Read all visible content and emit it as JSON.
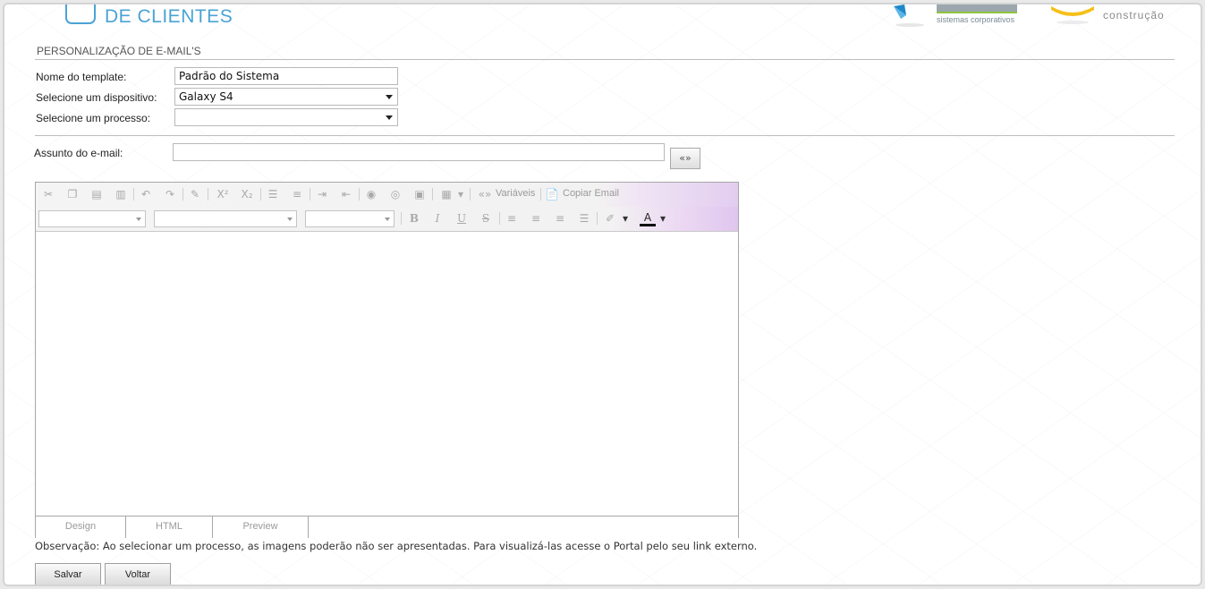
{
  "header": {
    "brand_title": "DE CLIENTES",
    "logo1_subtitle": "sistemas corporativos",
    "logo2_subtitle": "construção"
  },
  "page": {
    "section_title": "PERSONALIZAÇÃO DE E-MAIL'S"
  },
  "form": {
    "template_label": "Nome do template:",
    "template_value": "Padrão do Sistema",
    "device_label": "Selecione um dispositivo:",
    "device_value": "Galaxy S4",
    "process_label": "Selecione um processo:",
    "process_value": "",
    "subject_label": "Assunto do e-mail:",
    "subject_value": "",
    "variables_button": "«»"
  },
  "editor": {
    "toolbar": {
      "variables_label": "Variáveis",
      "copy_email_label": "Copiar Email",
      "superscript": "X²",
      "subscript": "X₂",
      "bold": "B",
      "italic": "I",
      "underline": "U",
      "strike": "S",
      "font_color": "A"
    },
    "tabs": [
      "Design",
      "HTML",
      "Preview"
    ],
    "active_tab": "Design"
  },
  "note": "Observação: Ao selecionar um processo, as imagens poderão não ser apresentadas. Para visualizá-las acesse o Portal pelo seu link externo.",
  "actions": {
    "save": "Salvar",
    "back": "Voltar"
  },
  "colors": {
    "brand": "#4aa3d6",
    "logo_green": "#8dc63f",
    "logo_yellow": "#f5c018"
  }
}
